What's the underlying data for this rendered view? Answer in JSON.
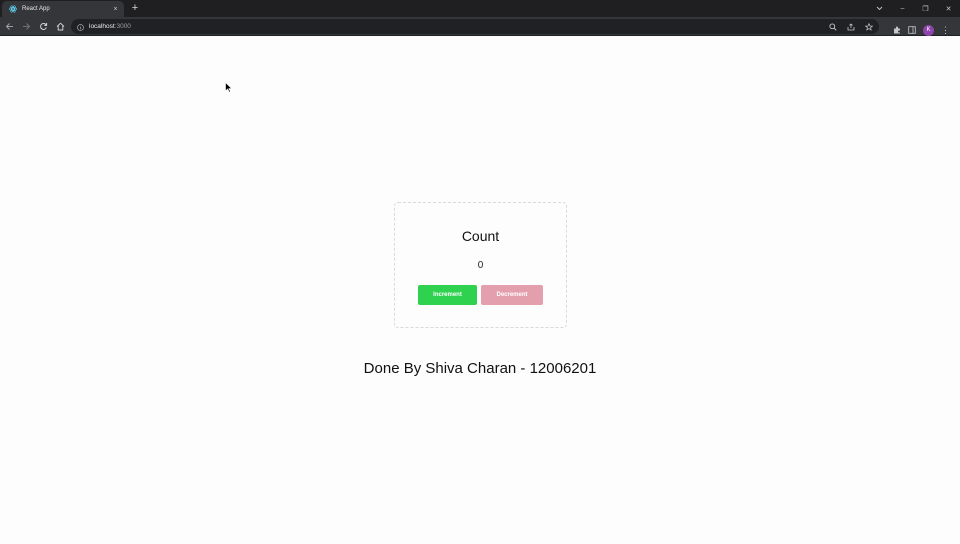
{
  "browser": {
    "tab_title": "React App",
    "tab_close": "×",
    "new_tab": "+",
    "url_host": "localhost",
    "url_port": ":3000",
    "profile_initial": "K",
    "window_controls": {
      "minimize": "–",
      "restore": "❐",
      "close": "✕"
    },
    "menu": "⋮"
  },
  "card": {
    "title": "Count",
    "value": "0",
    "increment_label": "Increment",
    "decrement_label": "Decrement"
  },
  "footer": {
    "text": "Done By Shiva Charan - 12006201"
  },
  "colors": {
    "increment": "#2fd24f",
    "decrement": "#e3a0ac"
  }
}
